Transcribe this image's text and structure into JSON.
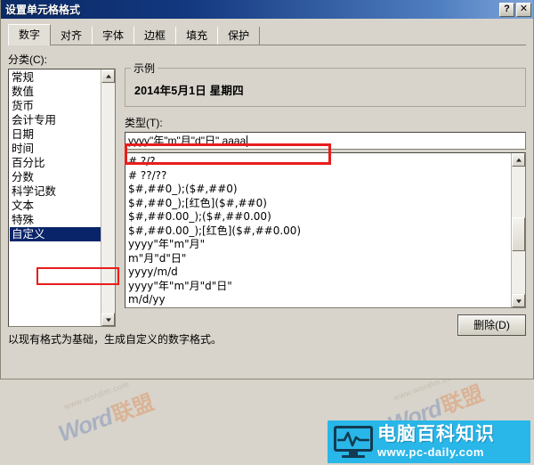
{
  "window": {
    "title": "设置单元格格式",
    "help_button": "?",
    "close_button": "✕"
  },
  "tabs": [
    {
      "label": "数字",
      "active": true
    },
    {
      "label": "对齐",
      "active": false
    },
    {
      "label": "字体",
      "active": false
    },
    {
      "label": "边框",
      "active": false
    },
    {
      "label": "填充",
      "active": false
    },
    {
      "label": "保护",
      "active": false
    }
  ],
  "category": {
    "label": "分类(C):",
    "items": [
      "常规",
      "数值",
      "货币",
      "会计专用",
      "日期",
      "时间",
      "百分比",
      "分数",
      "科学记数",
      "文本",
      "特殊",
      "自定义"
    ],
    "selected": "自定义"
  },
  "sample": {
    "legend": "示例",
    "value": "2014年5月1日 星期四"
  },
  "type": {
    "label": "类型(T):",
    "value": "yyyy\"年\"m\"月\"d\"日\" aaaa",
    "placeholder": "",
    "items": [
      "# ?/?",
      "# ??/??",
      "$#,##0_);($#,##0)",
      "$#,##0_);[红色]($#,##0)",
      "$#,##0.00_);($#,##0.00)",
      "$#,##0.00_);[红色]($#,##0.00)",
      "yyyy\"年\"m\"月\"",
      "m\"月\"d\"日\"",
      "yyyy/m/d",
      "yyyy\"年\"m\"月\"d\"日\"",
      "m/d/yy"
    ]
  },
  "buttons": {
    "delete": "删除(D)"
  },
  "description": "以现有格式为基础，生成自定义的数字格式。",
  "annotations": {
    "accent_color": "#e81d1d",
    "category_highlight": "自定义",
    "type_highlight": "yyyy\"年\"m\"月\"d\"日\" aaaa"
  },
  "watermarks": {
    "brand_word": "Word",
    "brand_cn": "联盟",
    "url": "www.wordlm.com"
  },
  "logo": {
    "name": "电脑百科知识",
    "url": "www.pc-daily.com"
  },
  "colors": {
    "dialog_bg": "#d8d4cb",
    "titlebar_from": "#0b2a66",
    "titlebar_to": "#7ea4d8",
    "selection_blue": "#0a246a",
    "annotation_red": "#e81d1d",
    "logo_cyan": "#29b6e8"
  }
}
